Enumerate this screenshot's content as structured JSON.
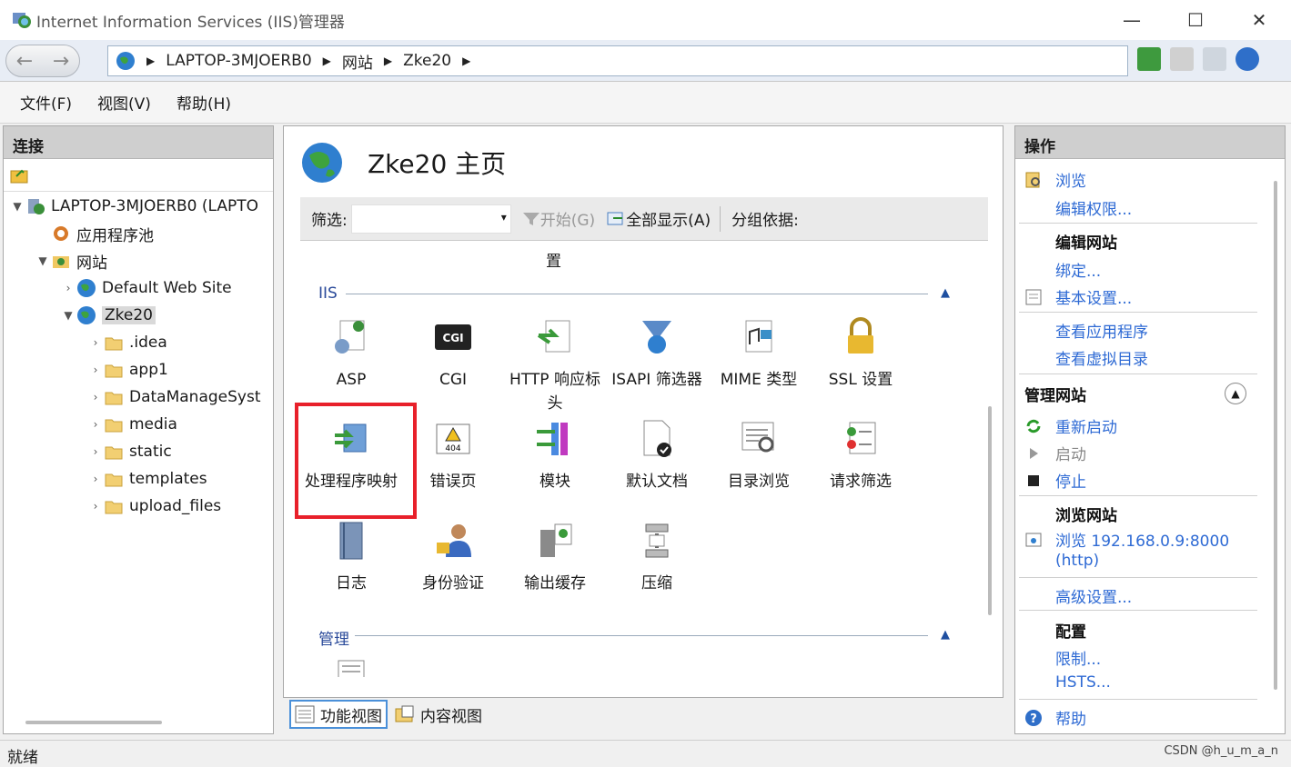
{
  "window": {
    "title": "Internet Information Services (IIS)管理器"
  },
  "address": {
    "crumbs": [
      "LAPTOP-3MJOERB0",
      "网站",
      "Zke20"
    ]
  },
  "menu": {
    "file": "文件(F)",
    "view": "视图(V)",
    "help": "帮助(H)"
  },
  "connections": {
    "header": "连接",
    "tree": [
      {
        "label": "LAPTOP-3MJOERB0 (LAPTO",
        "icon": "server-icon"
      },
      {
        "label": "应用程序池",
        "icon": "app-pool-icon"
      },
      {
        "label": "网站",
        "icon": "sites-folder-icon"
      },
      {
        "label": "Default Web Site",
        "icon": "globe-icon"
      },
      {
        "label": "Zke20",
        "icon": "globe-icon"
      },
      {
        "label": ".idea",
        "icon": "folder-icon"
      },
      {
        "label": "app1",
        "icon": "folder-icon"
      },
      {
        "label": "DataManageSyst",
        "icon": "folder-icon"
      },
      {
        "label": "media",
        "icon": "folder-icon"
      },
      {
        "label": "static",
        "icon": "folder-icon"
      },
      {
        "label": "templates",
        "icon": "folder-icon"
      },
      {
        "label": "upload_files",
        "icon": "folder-icon"
      }
    ]
  },
  "center": {
    "title": "Zke20 主页",
    "filter": {
      "label": "筛选:",
      "start": "开始(G)",
      "show_all": "全部显示(A)",
      "group_by": "分组依据:"
    },
    "cutoff_text": "置",
    "sections": {
      "iis": "IIS",
      "manage": "管理"
    },
    "features": [
      {
        "label": "ASP",
        "icon": "asp-icon"
      },
      {
        "label": "CGI",
        "icon": "cgi-icon"
      },
      {
        "label": "HTTP 响应标头",
        "icon": "http-headers-icon"
      },
      {
        "label": "ISAPI 筛选器",
        "icon": "isapi-filter-icon"
      },
      {
        "label": "MIME 类型",
        "icon": "mime-icon"
      },
      {
        "label": "SSL 设置",
        "icon": "lock-icon"
      },
      {
        "label": "处理程序映射",
        "icon": "handler-mapping-icon"
      },
      {
        "label": "错误页",
        "icon": "error-page-icon"
      },
      {
        "label": "模块",
        "icon": "modules-icon"
      },
      {
        "label": "默认文档",
        "icon": "default-doc-icon"
      },
      {
        "label": "目录浏览",
        "icon": "dir-browse-icon"
      },
      {
        "label": "请求筛选",
        "icon": "request-filter-icon"
      },
      {
        "label": "日志",
        "icon": "log-icon"
      },
      {
        "label": "身份验证",
        "icon": "auth-icon"
      },
      {
        "label": "输出缓存",
        "icon": "output-cache-icon"
      },
      {
        "label": "压缩",
        "icon": "compress-icon"
      }
    ],
    "view_tabs": {
      "features": "功能视图",
      "content": "内容视图"
    }
  },
  "actions": {
    "header": "操作",
    "browse": "浏览",
    "edit_perm": "编辑权限...",
    "edit_site": "编辑网站",
    "bindings": "绑定...",
    "basic": "基本设置...",
    "view_apps": "查看应用程序",
    "view_vdirs": "查看虚拟目录",
    "manage_site": "管理网站",
    "restart": "重新启动",
    "start": "启动",
    "stop": "停止",
    "browse_site": "浏览网站",
    "browse_url": "浏览 192.168.0.9:8000",
    "browse_proto": "(http)",
    "advanced": "高级设置...",
    "config": "配置",
    "limits": "限制...",
    "hsts": "HSTS...",
    "help": "帮助"
  },
  "status": {
    "text": "就绪"
  },
  "watermark": "CSDN @h_u_m_a_n"
}
